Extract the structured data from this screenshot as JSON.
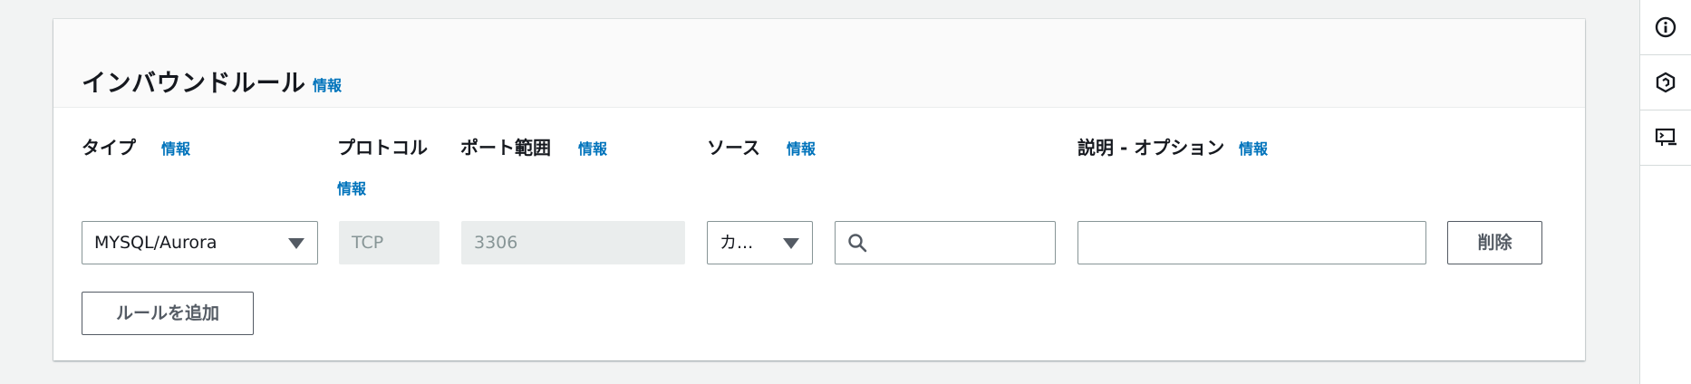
{
  "section": {
    "title": "インバウンドルール",
    "info_label": "情報"
  },
  "columns": {
    "type": {
      "label": "タイプ",
      "info": "情報"
    },
    "protocol": {
      "label": "プロトコル",
      "info": "情報"
    },
    "port_range": {
      "label": "ポート範囲",
      "info": "情報"
    },
    "source": {
      "label": "ソース",
      "info": "情報"
    },
    "description": {
      "label": "説明 - オプション",
      "info": "情報"
    }
  },
  "rule": {
    "type_value": "MYSQL/Aurora",
    "protocol_value": "TCP",
    "port_value": "3306",
    "source_type_value": "カ...",
    "source_search_value": "",
    "description_value": "",
    "delete_label": "削除"
  },
  "add_rule_label": "ルールを追加",
  "sidebar": {
    "icons": [
      "info-circle-icon",
      "hexagon-settings-icon",
      "screen-terminal-icon"
    ]
  },
  "colors": {
    "link": "#0073bb",
    "text": "#16191f",
    "border": "#879596",
    "disabled_bg": "#eaeded",
    "page_bg": "#f2f3f3"
  }
}
